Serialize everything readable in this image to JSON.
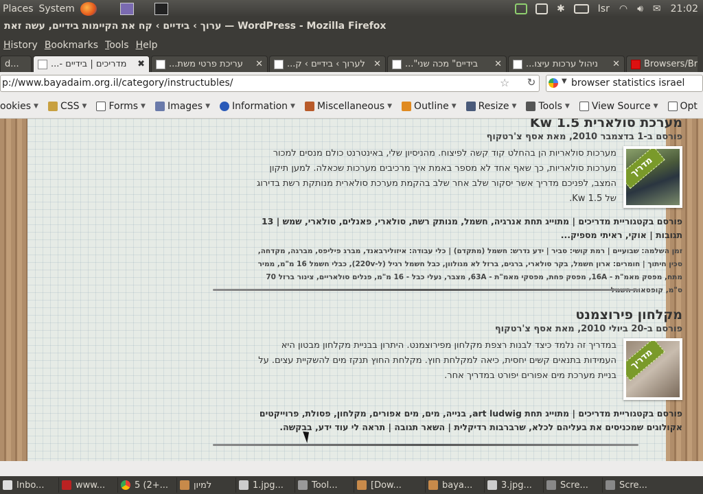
{
  "top_panel": {
    "places": "Places",
    "system": "System",
    "keyboard": "Isr",
    "clock": "21:02"
  },
  "window_title": "ערוך › בידיים › קח את הקיימות בידיים, עשה זאת — WordPress - Mozilla Firefox",
  "menu": [
    "History",
    "Bookmarks",
    "Tools",
    "Help"
  ],
  "tabs": [
    {
      "label": "d..."
    },
    {
      "label": "מדריכים | בידיים -...",
      "active": true
    },
    {
      "label": "עריכת פרטי משת..."
    },
    {
      "label": "לערוך › בידיים › ק..."
    },
    {
      "label": "בידיים\" מכה שני\"..."
    },
    {
      "label": "ניהול ערכות עיצו..."
    },
    {
      "label": "Browsers/Br"
    }
  ],
  "url": "p://www.bayadaim.org.il/category/instructubles/",
  "search_value": "browser statistics israel",
  "toolbar": [
    {
      "label": "ookies",
      "icon": "cookie-icon"
    },
    {
      "label": "CSS",
      "icon": "pencil-icon"
    },
    {
      "label": "Forms",
      "icon": "form-icon"
    },
    {
      "label": "Images",
      "icon": "image-icon"
    },
    {
      "label": "Information",
      "icon": "info-icon"
    },
    {
      "label": "Miscellaneous",
      "icon": "misc-icon"
    },
    {
      "label": "Outline",
      "icon": "pen-icon"
    },
    {
      "label": "Resize",
      "icon": "resize-icon"
    },
    {
      "label": "Tools",
      "icon": "tools-icon"
    },
    {
      "label": "View Source",
      "icon": "source-icon"
    },
    {
      "label": "Opt",
      "icon": "options-icon"
    }
  ],
  "posts": [
    {
      "title": "מערכת סולארית 1.5 Kw",
      "meta": "פורסם ב-1 בדצמבר 2010, מאת אסף צ'רטקוף",
      "badge": "מדריך",
      "excerpt": "מערכות סולאריות הן בהחלט קוד קשה לפיצוח. מהניסיון שלי, באינטרנט כולם מנסים למכור מערכות סולאריות, כך שאף אחד לא מספר באמת איך מרכיבים מערכות שכאלה. למען תיקון המצב, לפניכם מדריך אשר יסקור שלב אחר שלב בהקמת מערכת סולארית מנותקת רשת בדירוג של 1.5 Kw.",
      "cats": "פורסם בקטגוריית מדריכים | מתוייג תחת אנרגיה, חשמל, מנותק רשת, סולארי, פאנלים, סולארי, שמש | 13 תגובות | אוקי, ראיתי מספיק...",
      "details": "זמן השלמה: שבועיים | רמת קושי: סביר | ידע נדרש: חשמל (מתקדם) | כלי עבודה: איזולירבאנד, מברג פיליפס, מברגה, מקדחה, סכין חיתוך | חומרים: ארון חשמל, בקר סולארי, ברגים, ברזל לא מגולוון, כבל חשמל רגיל (ל-220v), כבלי חשמל 16 מ\"מ, ממיר מתח, מפסק מאמ\"ת - 16A, מפסק פחת, מפסקי מאמ\"ת - 63A, מצבר, נעלי כבל - 16 מ\"מ, פנלים סולאריים, צינור ברזל 70 ס\"מ, קופסאות חשמל"
    },
    {
      "title": "מקלחון פירוצמנט",
      "meta": "פורסם ב-20 ביולי 2010, מאת אסף צ'רטקוף",
      "badge": "מדריך",
      "excerpt": "במדריך זה נלמד כיצד לבנות רצפת מקלחון מפירוצמנט. היתרון בבניית מקלחון מבטון היא העמידות בתנאים קשים יחסית, כיאה למקלחת חוץ. מקלחת החוץ תנקז מים להשקיית עצים. על בניית מערכת מים אפורים יפורט במדריך אחר.",
      "cats": "פורסם בקטגוריית מדריכים | מתוייג תחת art ludwig, בנייה, מים, מים אפורים, מקלחון, פסולת, פרוייקטים אקולוגים שמכניסים את בעליהם לכלא, שרברבות רדיקלית | השאר תגובה | תראה לי עוד ידע, בבקשה."
    }
  ],
  "taskbar": [
    {
      "label": "Inbo...",
      "icon": "mail-icon"
    },
    {
      "label": "www...",
      "icon": "filezilla-icon"
    },
    {
      "label": "5 (2+...",
      "icon": "chrome-icon"
    },
    {
      "label": "למיון",
      "icon": "folder-icon"
    },
    {
      "label": "1.jpg...",
      "icon": "image-icon"
    },
    {
      "label": "Tool...",
      "icon": "tool-icon"
    },
    {
      "label": "[Dow...",
      "icon": "folder-icon"
    },
    {
      "label": "baya...",
      "icon": "folder-icon"
    },
    {
      "label": "3.jpg...",
      "icon": "image-icon"
    },
    {
      "label": "Scre...",
      "icon": "screenshot-icon"
    },
    {
      "label": "Scre...",
      "icon": "screenshot-icon"
    }
  ]
}
